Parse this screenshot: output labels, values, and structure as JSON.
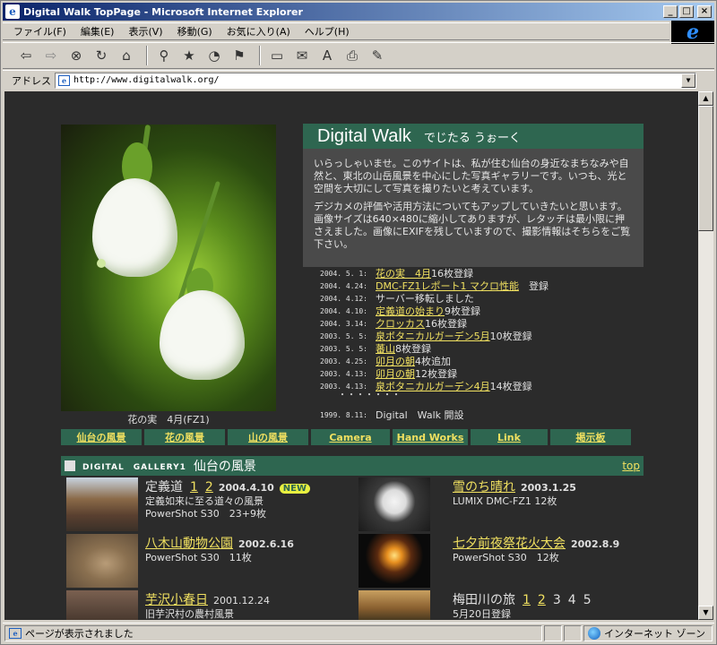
{
  "window": {
    "title": "Digital Walk TopPage - Microsoft Internet Explorer"
  },
  "menu": [
    "ファイル(F)",
    "編集(E)",
    "表示(V)",
    "移動(G)",
    "お気に入り(A)",
    "ヘルプ(H)"
  ],
  "address": {
    "label": "アドレス",
    "url": "http://www.digitalwalk.org/"
  },
  "status": {
    "left": "ページが表示されました",
    "zone": "インターネット ゾーン"
  },
  "hero": {
    "caption": "花の実　4月(FZ1)"
  },
  "intro": {
    "site_name": "Digital Walk",
    "site_kana": "でじたる うぉーく",
    "p1": "いらっしゃいませ。このサイトは、私が住む仙台の身近なまちなみや自然と、東北の山岳風景を中心にした写真ギャラリーです。いつも、光と空間を大切にして写真を撮りたいと考えています。",
    "p2": "デジカメの評価や活用方法についてもアップしていきたいと思います。画像サイズは640×480に縮小してありますが、レタッチは最小限に押さえました。画像にEXIFを残していますので、撮影情報はそちらをご覧下さい。"
  },
  "news": [
    {
      "date": "2004. 5. 1:",
      "link": "花の実　4月",
      "text": "16枚登録"
    },
    {
      "date": "2004. 4.24:",
      "link": "DMC-FZ1レポート1 マクロ性能",
      "text": "　登録"
    },
    {
      "date": "2004. 4.12:",
      "link": "",
      "text": "サーバー移転しました"
    },
    {
      "date": "2004. 4.10:",
      "link": "定義道の始まり",
      "text": "9枚登録"
    },
    {
      "date": "2004. 3.14:",
      "link": "クロッカス",
      "text": "16枚登録"
    },
    {
      "date": "2003. 5. 5:",
      "link": "泉ボタニカルガーデン5月",
      "text": "10枚登録"
    },
    {
      "date": "2003. 5. 5:",
      "link": "蕃山",
      "text": "8枚登録"
    },
    {
      "date": "2003. 4.25:",
      "link": "卯月の朝",
      "text": "4枚追加"
    },
    {
      "date": "2003. 4.13:",
      "link": "卯月の朝",
      "text": "12枚登録"
    },
    {
      "date": "2003. 4.13:",
      "link": "泉ボタニカルガーデン4月",
      "text": "14枚登録"
    }
  ],
  "news_dots": "・・・・・・・",
  "news_open": {
    "date": "1999. 8.11:",
    "text": "Digital　Walk 開設"
  },
  "nav": [
    "仙台の風景",
    "花の風景",
    "山の風景",
    "Camera",
    "Hand Works",
    "Link",
    "掲示板"
  ],
  "gallery": {
    "tag": "DIGITAL　GALLERY1",
    "title": "仙台の風景",
    "top_link": "top",
    "items": [
      {
        "title": "定義道",
        "pages": [
          "1",
          "2"
        ],
        "date": "2004.4.10",
        "badge": "NEW",
        "desc": "定義如来に至る道々の風景",
        "camera": "PowerShot S30　23+9枚"
      },
      {
        "title": "雪のち晴れ",
        "date": "2003.1.25",
        "camera": "LUMIX DMC-FZ1 12枚"
      },
      {
        "title": "八木山動物公園",
        "date": "2002.6.16",
        "camera": "PowerShot S30　11枚"
      },
      {
        "title": "七夕前夜祭花火大会",
        "date": "2002.8.9",
        "camera": "PowerShot S30　12枚"
      },
      {
        "title": "芋沢小春日",
        "date": "2001.12.24",
        "desc": "旧芋沢村の農村風景"
      },
      {
        "title": "梅田川の旅",
        "pages_link": [
          "1",
          "2"
        ],
        "pages_plain": [
          "3",
          "4",
          "5"
        ],
        "desc": "5月20日登録"
      }
    ]
  }
}
